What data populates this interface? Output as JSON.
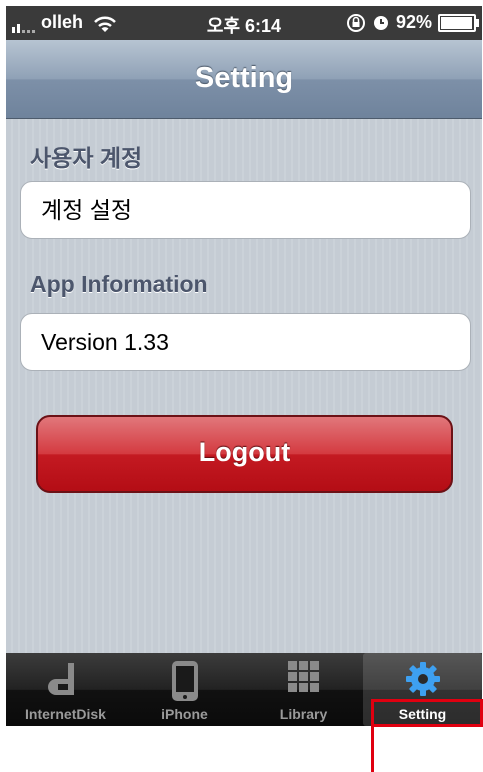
{
  "status_bar": {
    "carrier": "olleh",
    "time": "오후 6:14",
    "battery": "92%",
    "battery_level": 0.92
  },
  "nav": {
    "title": "Setting"
  },
  "sections": [
    {
      "label": "사용자 계정",
      "cell": "계정 설정"
    },
    {
      "label": "App Information",
      "cell": "Version 1.33"
    }
  ],
  "logout_label": "Logout",
  "tabs": [
    {
      "label": "InternetDisk",
      "icon": "internetdisk-icon"
    },
    {
      "label": "iPhone",
      "icon": "iphone-icon"
    },
    {
      "label": "Library",
      "icon": "grid-icon"
    },
    {
      "label": "Setting",
      "icon": "gear-icon",
      "active": true
    }
  ],
  "colors": {
    "nav_blue": "#8fa1b6",
    "logout_red": "#d43a40",
    "tab_active_icon": "#3ea0f0",
    "annotation_red": "#e00010"
  }
}
